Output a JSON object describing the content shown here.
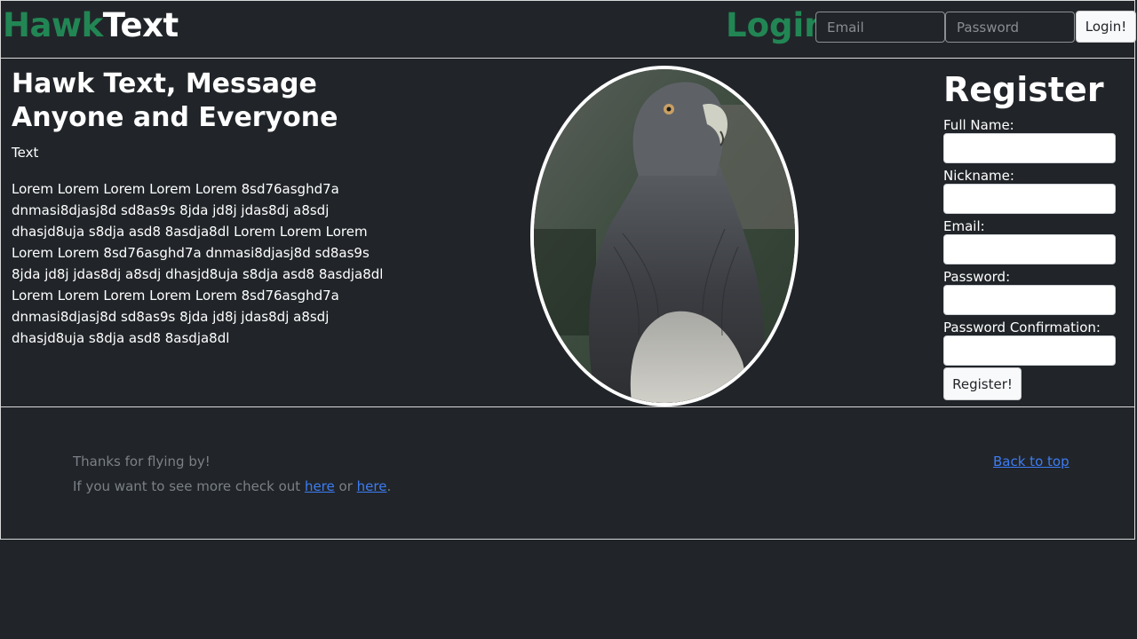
{
  "header": {
    "brand_hawk": "Hawk",
    "brand_text": "Text",
    "login_title": "Login",
    "email_placeholder": "Email",
    "password_placeholder": "Password",
    "login_button": "Login!"
  },
  "hero": {
    "title": "Hawk Text, Message Anyone and Everyone",
    "subtitle": "Text",
    "body": "Lorem Lorem Lorem Lorem Lorem 8sd76asghd7a dnmasi8djasj8d sd8as9s 8jda jd8j jdas8dj a8sdj dhasjd8uja s8dja asd8 8asdja8dl Lorem Lorem Lorem Lorem Lorem 8sd76asghd7a dnmasi8djasj8d sd8as9s 8jda jd8j jdas8dj a8sdj dhasjd8uja s8dja asd8 8asdja8dl Lorem Lorem Lorem Lorem Lorem 8sd76asghd7a dnmasi8djasj8d sd8as9s 8jda jd8j jdas8dj a8sdj dhasjd8uja s8dja asd8 8asdja8dl"
  },
  "register": {
    "title": "Register",
    "full_name_label": "Full Name:",
    "nickname_label": "Nickname:",
    "email_label": "Email:",
    "password_label": "Password:",
    "password_confirm_label": "Password Confirmation:",
    "button": "Register!"
  },
  "footer": {
    "thanks": "Thanks for flying by!",
    "more_prefix": "If you want to see more check out ",
    "link1": "here",
    "or": " or ",
    "link2": "here",
    "period": ".",
    "back_to_top": "Back to top"
  },
  "colors": {
    "background": "#212529",
    "brand_green": "#228654",
    "link_blue": "#3d7cf4",
    "muted_text": "#7b8087"
  }
}
